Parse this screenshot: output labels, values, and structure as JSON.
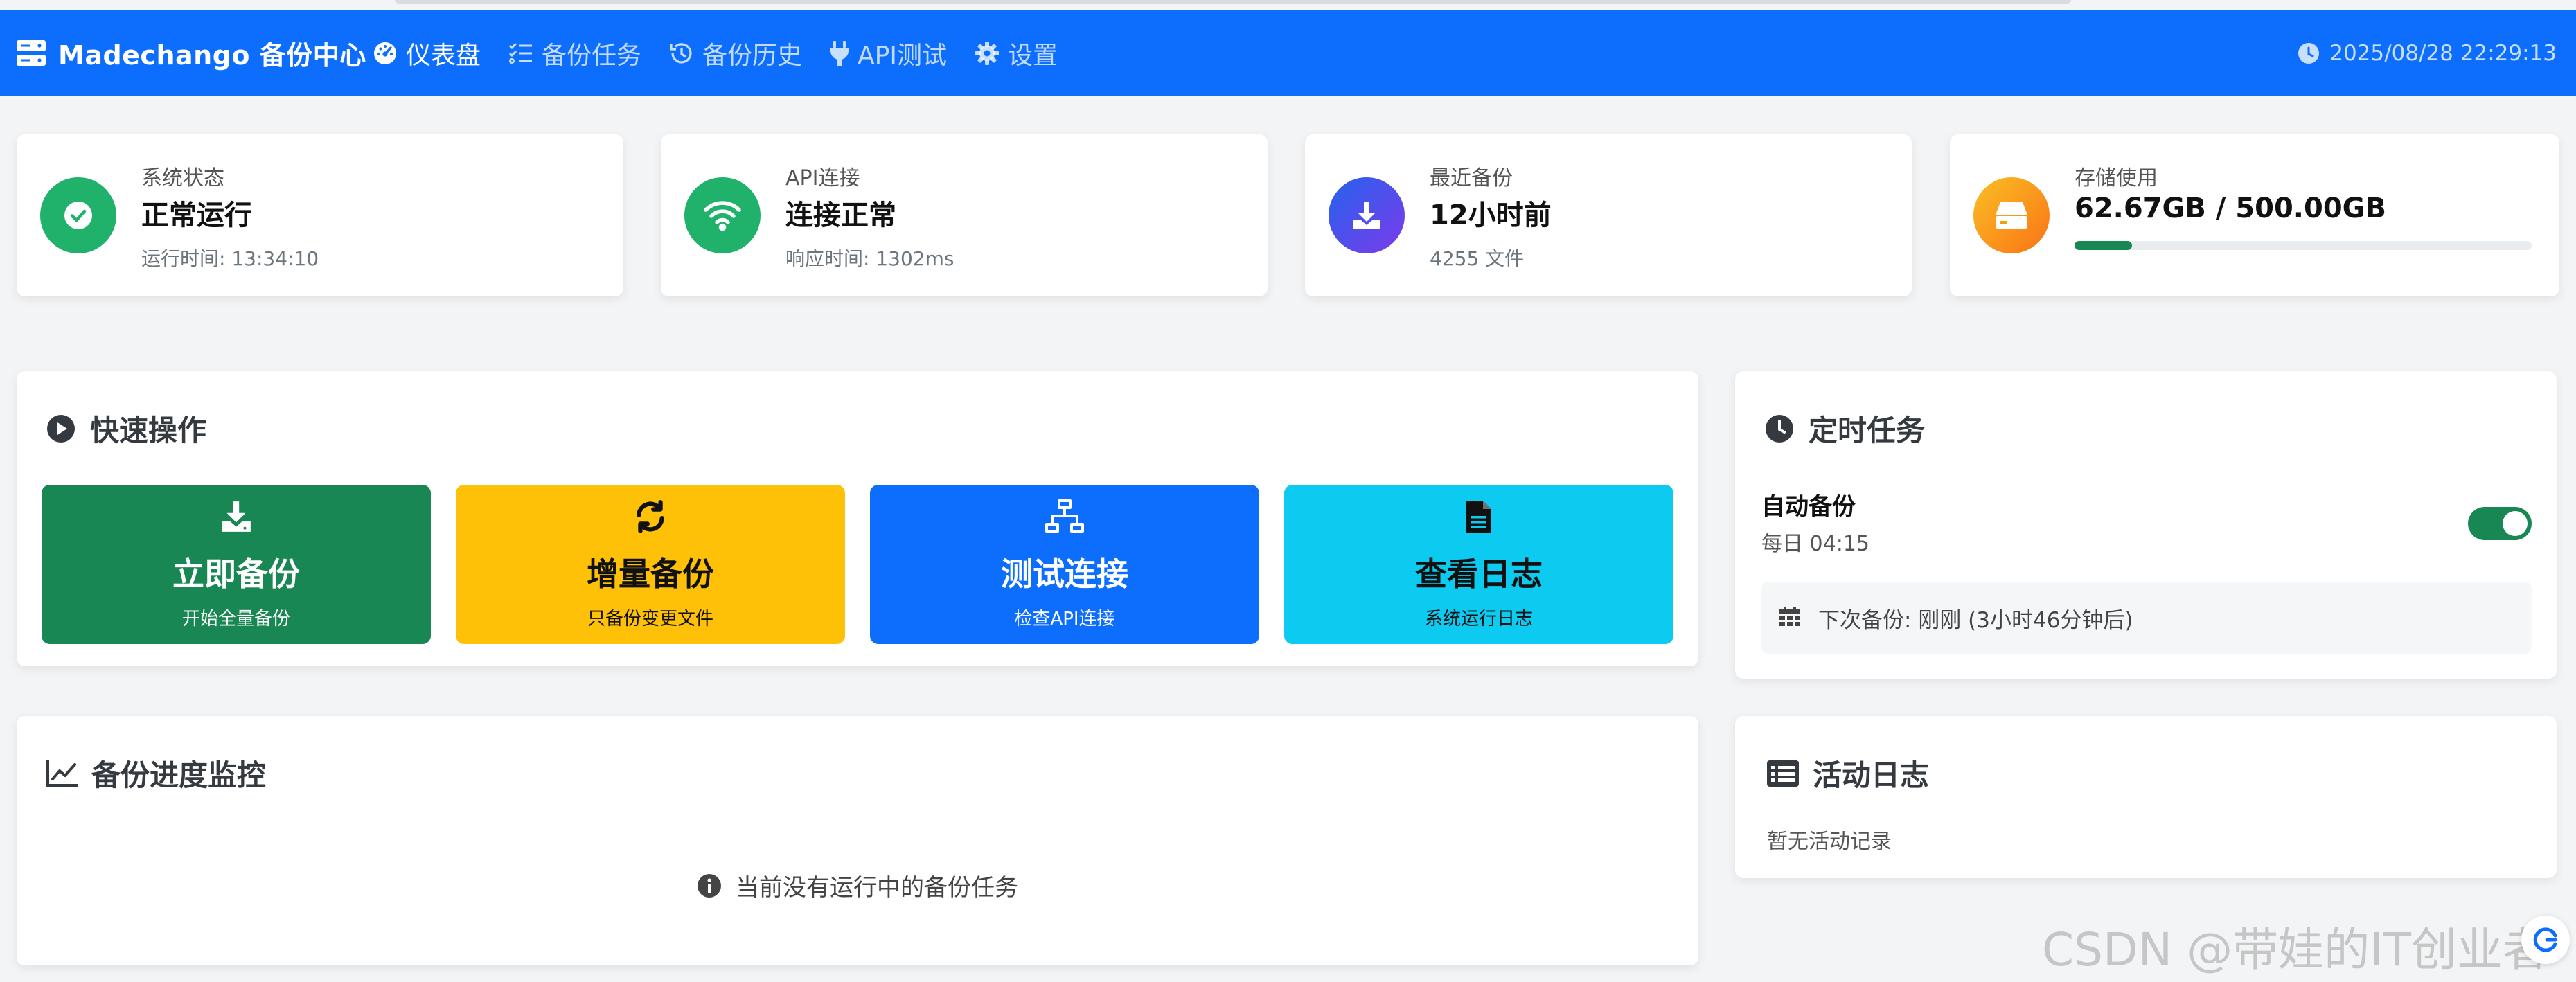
{
  "nav": {
    "brand": "Madechango 备份中心",
    "items": [
      {
        "label": "仪表盘",
        "icon": "tachometer-icon"
      },
      {
        "label": "备份任务",
        "icon": "tasks-icon"
      },
      {
        "label": "备份历史",
        "icon": "history-icon"
      },
      {
        "label": "API测试",
        "icon": "plug-icon"
      },
      {
        "label": "设置",
        "icon": "gear-icon"
      }
    ],
    "active": "仪表盘",
    "datetime": "2025/08/28 22:29:13"
  },
  "stats": [
    {
      "label": "系统状态",
      "value": "正常运行",
      "sub": "运行时间: 13:34:10",
      "icon": "check-circle-icon",
      "color": "#20b26b"
    },
    {
      "label": "API连接",
      "value": "连接正常",
      "sub": "响应时间: 1302ms",
      "icon": "wifi-icon",
      "color": "#20b26b"
    },
    {
      "label": "最近备份",
      "value": "12小时前",
      "sub": "4255 文件",
      "icon": "download-icon",
      "color": "#4f46e5"
    },
    {
      "label": "存储使用",
      "value": "62.67GB / 500.00GB",
      "usage_fraction": 0.1253,
      "icon": "hdd-icon",
      "color": "#f59e0b"
    }
  ],
  "quick_actions": {
    "title": "快速操作",
    "buttons": [
      {
        "title": "立即备份",
        "sub": "开始全量备份",
        "icon": "download-icon",
        "bg": "#198754",
        "fg": "#ffffff"
      },
      {
        "title": "增量备份",
        "sub": "只备份变更文件",
        "icon": "sync-icon",
        "bg": "#ffc107",
        "fg": "#111111"
      },
      {
        "title": "测试连接",
        "sub": "检查API连接",
        "icon": "network-icon",
        "bg": "#0d6efd",
        "fg": "#ffffff"
      },
      {
        "title": "查看日志",
        "sub": "系统运行日志",
        "icon": "file-icon",
        "bg": "#0dcaf0",
        "fg": "#111111"
      }
    ]
  },
  "schedule": {
    "title": "定时任务",
    "name": "自动备份",
    "time": "每日 04:15",
    "enabled": true,
    "next": "下次备份: 刚刚 (3小时46分钟后)"
  },
  "monitor": {
    "title": "备份进度监控",
    "empty": "当前没有运行中的备份任务"
  },
  "activity": {
    "title": "活动日志",
    "empty": "暂无活动记录"
  },
  "watermark": "CSDN @带娃的IT创业者",
  "colors": {
    "primary": "#0d6efd",
    "success": "#198754",
    "warning": "#ffc107",
    "info": "#0dcaf0"
  }
}
